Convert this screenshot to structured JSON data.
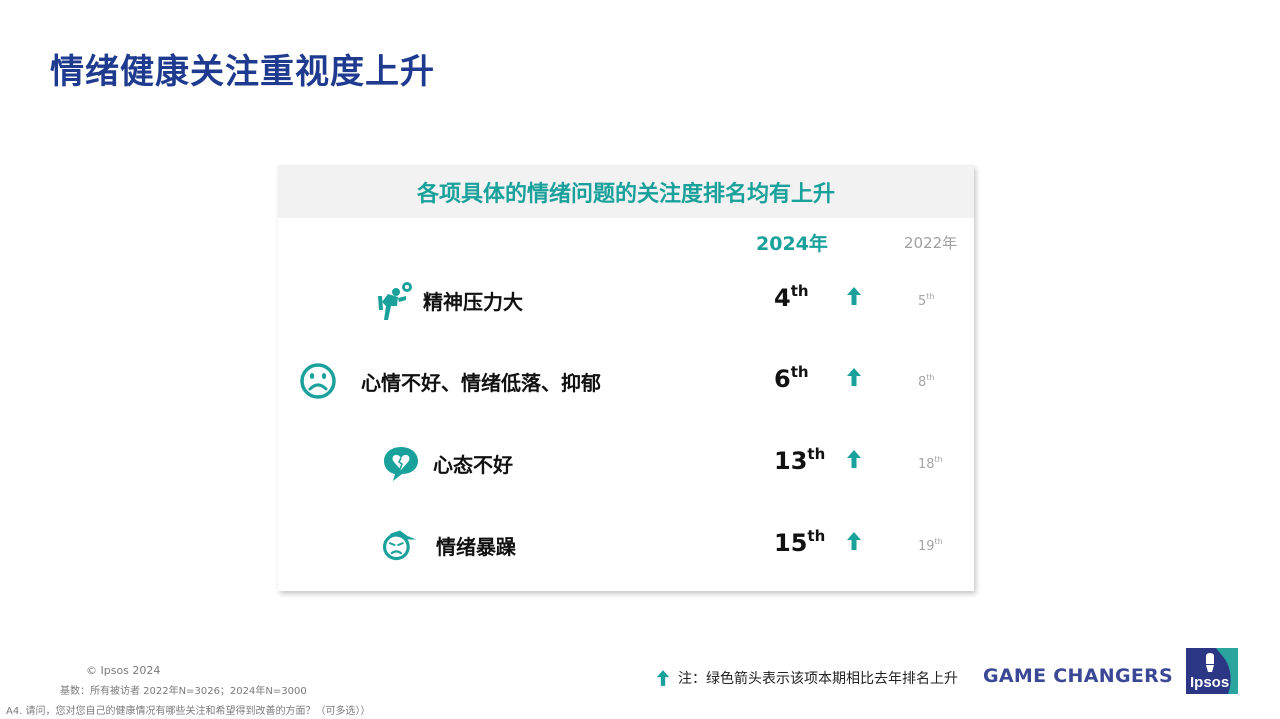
{
  "page": {
    "title": "情绪健康关注重视度上升"
  },
  "card": {
    "header": "各项具体的情绪问题的关注度排名均有上升",
    "col_2024": "2024年",
    "col_2022": "2022年",
    "rows": [
      {
        "label": "精神压力大",
        "rank_2024": "4",
        "rank_2024_suffix": "th",
        "rank_2022": "5",
        "rank_2022_suffix": "th",
        "icon": "stressed-person-icon"
      },
      {
        "label": "心情不好、情绪低落、抑郁",
        "rank_2024": "6",
        "rank_2024_suffix": "th",
        "rank_2022": "8",
        "rank_2022_suffix": "th",
        "icon": "sad-face-icon"
      },
      {
        "label": "心态不好",
        "rank_2024": "13",
        "rank_2024_suffix": "th",
        "rank_2022": "18",
        "rank_2022_suffix": "th",
        "icon": "broken-heart-bubble-icon"
      },
      {
        "label": "情绪暴躁",
        "rank_2024": "15",
        "rank_2024_suffix": "th",
        "rank_2022": "19",
        "rank_2022_suffix": "th",
        "icon": "angry-face-icon"
      }
    ]
  },
  "footer": {
    "copyright": "© Ipsos 2024",
    "base": "基数：所有被访者  2022年N=3026；2024年N=3000",
    "question": "A4. 请问，您对您自己的健康情况有哪些关注和希望得到改善的方面？（可多选））",
    "note": "注：绿色箭头表示该项本期相比去年排名上升",
    "tagline": "GAME CHANGERS",
    "logo_text": "Ipsos"
  },
  "colors": {
    "title": "#1f3b8f",
    "accent": "#1aa19b",
    "header_bg": "#f2f2f2",
    "brand": "#3b4896",
    "logo_bg": "#2b3785",
    "logo_accent": "#2aa59d"
  }
}
